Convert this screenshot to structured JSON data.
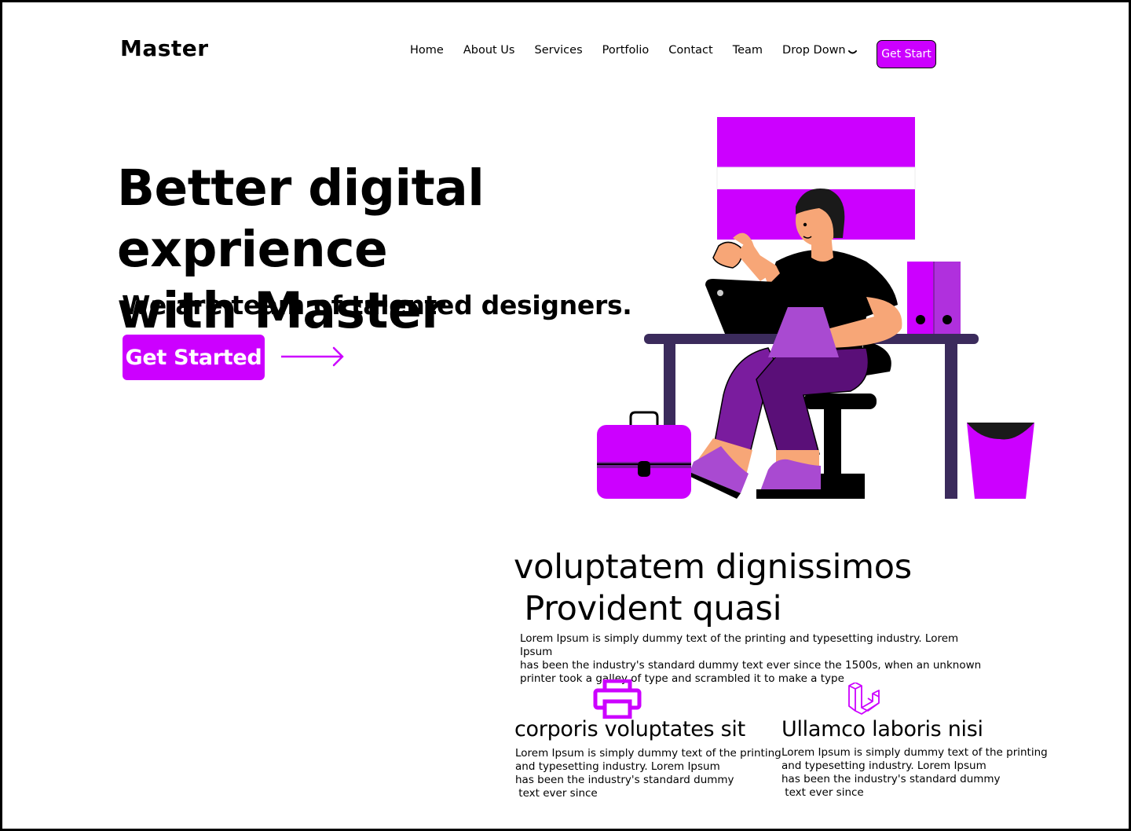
{
  "header": {
    "logo": "Master",
    "nav": [
      {
        "label": "Home"
      },
      {
        "label": "About Us"
      },
      {
        "label": "Services"
      },
      {
        "label": "Portfolio"
      },
      {
        "label": "Contact"
      },
      {
        "label": "Team"
      },
      {
        "label": "Drop Down"
      }
    ],
    "cta_label": "Get Start"
  },
  "hero": {
    "title_line1": "Better digital exprience",
    "title_line2": "with Master",
    "subtitle": "We are team of talented designers.",
    "cta_label": "Get Started",
    "arrow_icon": "arrow-right-icon"
  },
  "colors": {
    "accent": "#cc00ff",
    "dark": "#000000",
    "desk": "#3b2b5c",
    "skin": "#f7a677",
    "purple_dark": "#5a0f78"
  },
  "section": {
    "title_line1": "voluptatem dignissimos",
    "title_line2": " Provident quasi",
    "body_line1": "Lorem Ipsum is simply dummy text of the printing and typesetting industry. Lorem Ipsum",
    "body_line2": "has been the industry's standard dummy text ever since the 1500s, when an unknown",
    "body_line3": "printer took a galley of type and scrambled it to make a type"
  },
  "features": [
    {
      "icon": "printer-icon",
      "title": "corporis voluptates sit",
      "body_line1": "Lorem Ipsum is simply dummy text of the printing",
      "body_line2": "and typesetting industry. Lorem Ipsum",
      "body_line3": "has been the industry's standard dummy",
      "body_line4": " text ever since"
    },
    {
      "icon": "laravel-icon",
      "title": "Ullamco laboris nisi",
      "body_line1": "Lorem Ipsum is simply dummy text of the printing",
      "body_line2": "and typesetting industry. Lorem Ipsum",
      "body_line3": "has been the industry's standard dummy",
      "body_line4": " text ever since"
    }
  ]
}
